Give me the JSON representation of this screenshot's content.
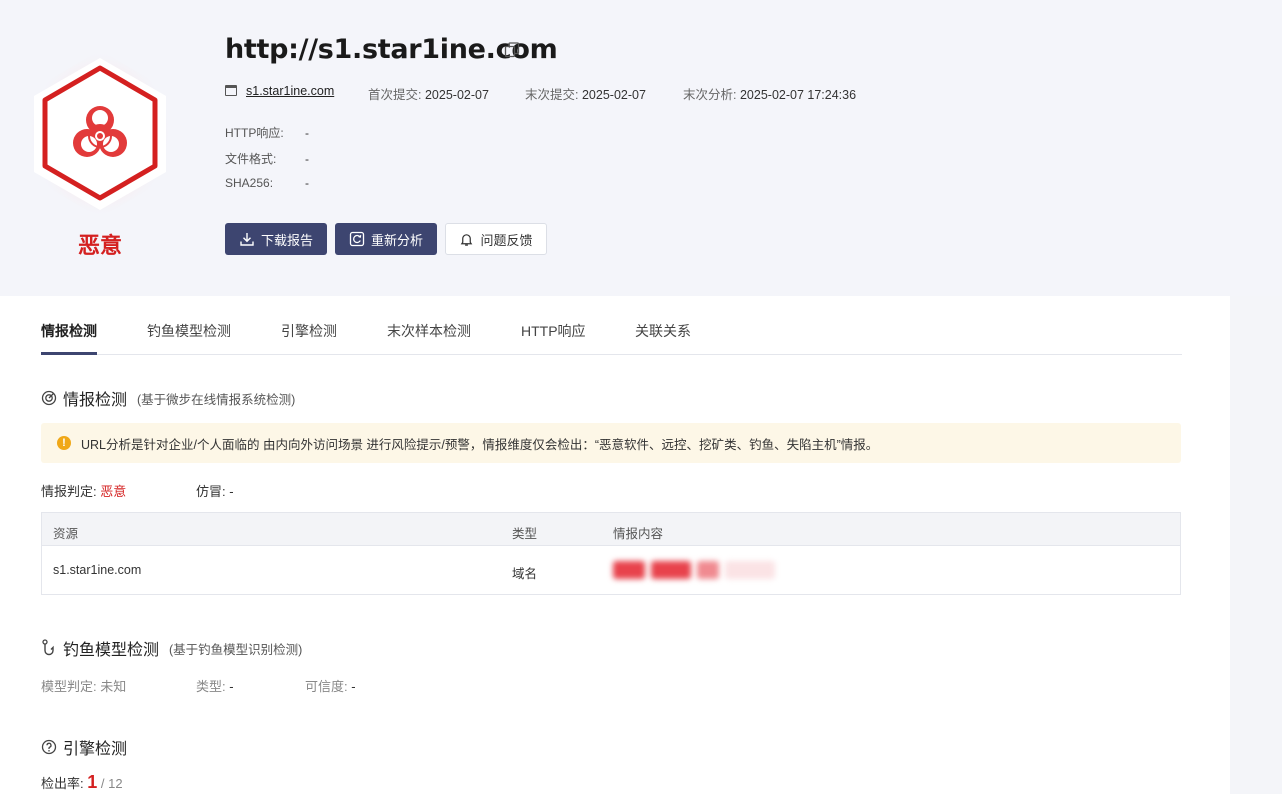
{
  "header": {
    "url": "http://s1.star1ine.com",
    "verdict": "恶意",
    "domain": "s1.star1ine.com",
    "first_submit_label": "首次提交:",
    "first_submit": "2025-02-07",
    "last_submit_label": "末次提交:",
    "last_submit": "2025-02-07",
    "last_analysis_label": "末次分析:",
    "last_analysis": "2025-02-07 17:24:36",
    "http_label": "HTTP响应:",
    "http_value": "-",
    "format_label": "文件格式:",
    "format_value": "-",
    "sha_label": "SHA256:",
    "sha_value": "-"
  },
  "actions": {
    "download": "下载报告",
    "reanalyze": "重新分析",
    "feedback": "问题反馈"
  },
  "tabs": [
    "情报检测",
    "钓鱼模型检测",
    "引擎检测",
    "末次样本检测",
    "HTTP响应",
    "关联关系"
  ],
  "intel": {
    "title": "情报检测",
    "subtitle": "(基于微步在线情报系统检测)",
    "notice": "URL分析是针对企业/个人面临的 由内向外访问场景 进行风险提示/预警，情报维度仅会检出：“恶意软件、远控、挖矿类、钓鱼、失陷主机”情报。",
    "judge_label": "情报判定:",
    "judge_value": "恶意",
    "fake_label": "仿冒:",
    "fake_value": "-",
    "columns": [
      "资源",
      "类型",
      "情报内容"
    ],
    "rows": [
      {
        "resource": "s1.star1ine.com",
        "type": "域名"
      }
    ]
  },
  "phishing": {
    "title": "钓鱼模型检测",
    "subtitle": "(基于钓鱼模型识别检测)",
    "model_label": "模型判定:",
    "model_value": "未知",
    "type_label": "类型:",
    "type_value": "-",
    "confidence_label": "可信度:",
    "confidence_value": "-"
  },
  "engine": {
    "title": "引擎检测",
    "rate_label": "检出率:",
    "detected": "1",
    "total": "/ 12"
  },
  "colors": {
    "malicious": "#d42020",
    "primary_button": "#3d4570",
    "notice_bg": "#fdf7e7"
  }
}
